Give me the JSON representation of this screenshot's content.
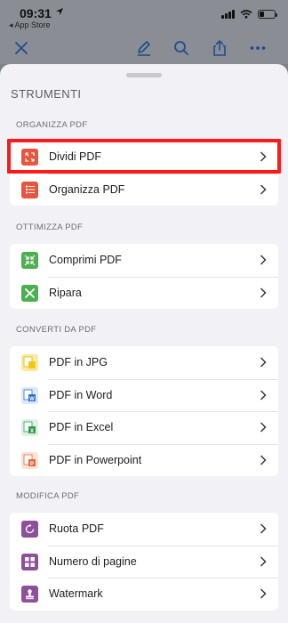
{
  "status": {
    "time": "09:31",
    "back_app": "◂ App Store"
  },
  "sheet": {
    "title": "STRUMENTI"
  },
  "sections": [
    {
      "header": "ORGANIZZA PDF",
      "items": [
        {
          "label": "Dividi PDF",
          "icon": "split-icon"
        },
        {
          "label": "Organizza PDF",
          "icon": "organize-icon"
        }
      ]
    },
    {
      "header": "OTTIMIZZA PDF",
      "items": [
        {
          "label": "Comprimi PDF",
          "icon": "compress-icon"
        },
        {
          "label": "Ripara",
          "icon": "repair-icon"
        }
      ]
    },
    {
      "header": "CONVERTI DA PDF",
      "items": [
        {
          "label": "PDF in JPG",
          "icon": "jpg-icon"
        },
        {
          "label": "PDF in Word",
          "icon": "word-icon"
        },
        {
          "label": "PDF in Excel",
          "icon": "excel-icon"
        },
        {
          "label": "PDF in Powerpoint",
          "icon": "powerpoint-icon"
        }
      ]
    },
    {
      "header": "MODIFICA PDF",
      "items": [
        {
          "label": "Ruota PDF",
          "icon": "rotate-icon"
        },
        {
          "label": "Numero di pagine",
          "icon": "page-numbers-icon"
        },
        {
          "label": "Watermark",
          "icon": "watermark-icon"
        }
      ]
    }
  ],
  "colors": {
    "organize": "#e8553e",
    "optimize": "#4caf50",
    "jpg": "#f5c518",
    "word": "#2b6fd6",
    "excel": "#2e9d4e",
    "powerpoint": "#e8683a",
    "edit": "#8e4f9c",
    "highlight": "#ff1a1a"
  }
}
